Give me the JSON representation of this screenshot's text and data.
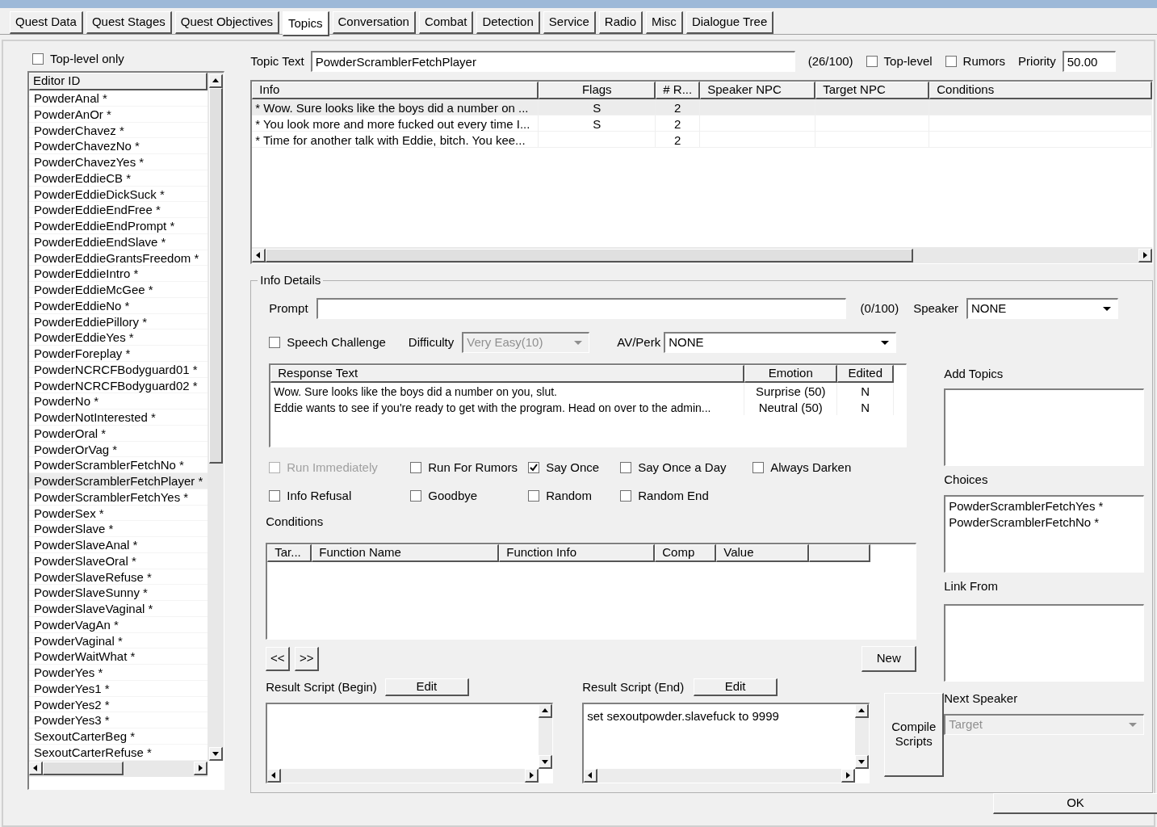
{
  "tabs": [
    {
      "label": "Quest Data",
      "selected": false
    },
    {
      "label": "Quest Stages",
      "selected": false
    },
    {
      "label": "Quest Objectives",
      "selected": false
    },
    {
      "label": "Topics",
      "selected": true
    },
    {
      "label": "Conversation",
      "selected": false
    },
    {
      "label": "Combat",
      "selected": false
    },
    {
      "label": "Detection",
      "selected": false
    },
    {
      "label": "Service",
      "selected": false
    },
    {
      "label": "Radio",
      "selected": false
    },
    {
      "label": "Misc",
      "selected": false
    },
    {
      "label": "Dialogue Tree",
      "selected": false
    }
  ],
  "topic_list": {
    "top_level_only": {
      "label": "Top-level only",
      "checked": false
    },
    "column": "Editor ID",
    "items": [
      {
        "label": "PowderAnal *",
        "selected": false
      },
      {
        "label": "PowderAnOr *",
        "selected": false
      },
      {
        "label": "PowderChavez *",
        "selected": false
      },
      {
        "label": "PowderChavezNo *",
        "selected": false
      },
      {
        "label": "PowderChavezYes *",
        "selected": false
      },
      {
        "label": "PowderEddieCB *",
        "selected": false
      },
      {
        "label": "PowderEddieDickSuck *",
        "selected": false
      },
      {
        "label": "PowderEddieEndFree *",
        "selected": false
      },
      {
        "label": "PowderEddieEndPrompt *",
        "selected": false
      },
      {
        "label": "PowderEddieEndSlave *",
        "selected": false
      },
      {
        "label": "PowderEddieGrantsFreedom *",
        "selected": false
      },
      {
        "label": "PowderEddieIntro *",
        "selected": false
      },
      {
        "label": "PowderEddieMcGee *",
        "selected": false
      },
      {
        "label": "PowderEddieNo *",
        "selected": false
      },
      {
        "label": "PowderEddiePillory *",
        "selected": false
      },
      {
        "label": "PowderEddieYes *",
        "selected": false
      },
      {
        "label": "PowderForeplay *",
        "selected": false
      },
      {
        "label": "PowderNCRCFBodyguard01 *",
        "selected": false
      },
      {
        "label": "PowderNCRCFBodyguard02 *",
        "selected": false
      },
      {
        "label": "PowderNo *",
        "selected": false
      },
      {
        "label": "PowderNotInterested *",
        "selected": false
      },
      {
        "label": "PowderOral *",
        "selected": false
      },
      {
        "label": "PowderOrVag *",
        "selected": false
      },
      {
        "label": "PowderScramblerFetchNo *",
        "selected": false
      },
      {
        "label": "PowderScramblerFetchPlayer *",
        "selected": true
      },
      {
        "label": "PowderScramblerFetchYes *",
        "selected": false
      },
      {
        "label": "PowderSex *",
        "selected": false
      },
      {
        "label": "PowderSlave *",
        "selected": false
      },
      {
        "label": "PowderSlaveAnal *",
        "selected": false
      },
      {
        "label": "PowderSlaveOral *",
        "selected": false
      },
      {
        "label": "PowderSlaveRefuse *",
        "selected": false
      },
      {
        "label": "PowderSlaveSunny *",
        "selected": false
      },
      {
        "label": "PowderSlaveVaginal *",
        "selected": false
      },
      {
        "label": "PowderVagAn *",
        "selected": false
      },
      {
        "label": "PowderVaginal *",
        "selected": false
      },
      {
        "label": "PowderWaitWhat *",
        "selected": false
      },
      {
        "label": "PowderYes *",
        "selected": false
      },
      {
        "label": "PowderYes1 *",
        "selected": false
      },
      {
        "label": "PowderYes2 *",
        "selected": false
      },
      {
        "label": "PowderYes3 *",
        "selected": false
      },
      {
        "label": "SexoutCarterBeg *",
        "selected": false
      },
      {
        "label": "SexoutCarterRefuse *",
        "selected": false
      }
    ]
  },
  "topic": {
    "label": "Topic Text",
    "value": "PowderScramblerFetchPlayer",
    "count": "(26/100)",
    "top_level": {
      "label": "Top-level",
      "checked": false
    },
    "rumors": {
      "label": "Rumors",
      "checked": false
    },
    "priority_label": "Priority",
    "priority": "50.00"
  },
  "info_table": {
    "columns": [
      "Info",
      "Flags",
      "# R...",
      "Speaker NPC",
      "Target NPC",
      "Conditions"
    ],
    "rows": [
      {
        "cells": [
          "* Wow. Sure looks like the boys did a number on ...",
          "S",
          "2",
          "",
          "",
          ""
        ],
        "selected": true
      },
      {
        "cells": [
          "* You look more and more fucked out every time I...",
          "S",
          "2",
          "",
          "",
          ""
        ],
        "selected": false
      },
      {
        "cells": [
          "* Time for another talk with Eddie, bitch. You kee...",
          "",
          "2",
          "",
          "",
          ""
        ],
        "selected": false
      }
    ]
  },
  "info_details": {
    "title": "Info Details",
    "prompt_label": "Prompt",
    "prompt_count": "(0/100)",
    "speaker_label": "Speaker",
    "speaker": "NONE",
    "speech_challenge": {
      "label": "Speech Challenge",
      "checked": false
    },
    "difficulty_label": "Difficulty",
    "difficulty": "Very Easy(10)",
    "avperk_label": "AV/Perk",
    "avperk": "NONE",
    "responses": {
      "columns": [
        "Response Text",
        "Emotion",
        "Edited"
      ],
      "rows": [
        {
          "cells": [
            "Wow. Sure looks like the boys did a number on you, slut.",
            "Surprise (50)",
            "N"
          ]
        },
        {
          "cells": [
            "Eddie wants to see if you're ready to get with the program. Head on over to the admin...",
            "Neutral (50)",
            "N"
          ]
        }
      ]
    },
    "flags": [
      {
        "label": "Run Immediately",
        "checked": false,
        "disabled": true
      },
      {
        "label": "Run For Rumors",
        "checked": false,
        "disabled": false
      },
      {
        "label": "Say Once",
        "checked": true,
        "disabled": false
      },
      {
        "label": "Say Once a Day",
        "checked": false,
        "disabled": false
      },
      {
        "label": "Always Darken",
        "checked": false,
        "disabled": false
      },
      {
        "label": "Info Refusal",
        "checked": false,
        "disabled": false
      },
      {
        "label": "Goodbye",
        "checked": false,
        "disabled": false
      },
      {
        "label": "Random",
        "checked": false,
        "disabled": false
      },
      {
        "label": "Random End",
        "checked": false,
        "disabled": false
      }
    ],
    "conditions_label": "Conditions",
    "conditions_columns": [
      "Tar...",
      "Function Name",
      "Function Info",
      "Comp",
      "Value"
    ],
    "prev": "<<",
    "next": ">>",
    "new": "New",
    "script_begin": {
      "label": "Result Script (Begin)",
      "edit": "Edit"
    },
    "script_end": {
      "label": "Result Script (End)",
      "edit": "Edit",
      "text": "set sexoutpowder.slavefuck to 9999"
    },
    "compile": "Compile Scripts",
    "add_topics": {
      "label": "Add Topics"
    },
    "choices": {
      "label": "Choices",
      "items": [
        "PowderScramblerFetchYes *",
        "PowderScramblerFetchNo *"
      ]
    },
    "link_from": {
      "label": "Link From"
    },
    "next_speaker": {
      "label": "Next Speaker",
      "value": "Target"
    }
  },
  "ok": "OK"
}
